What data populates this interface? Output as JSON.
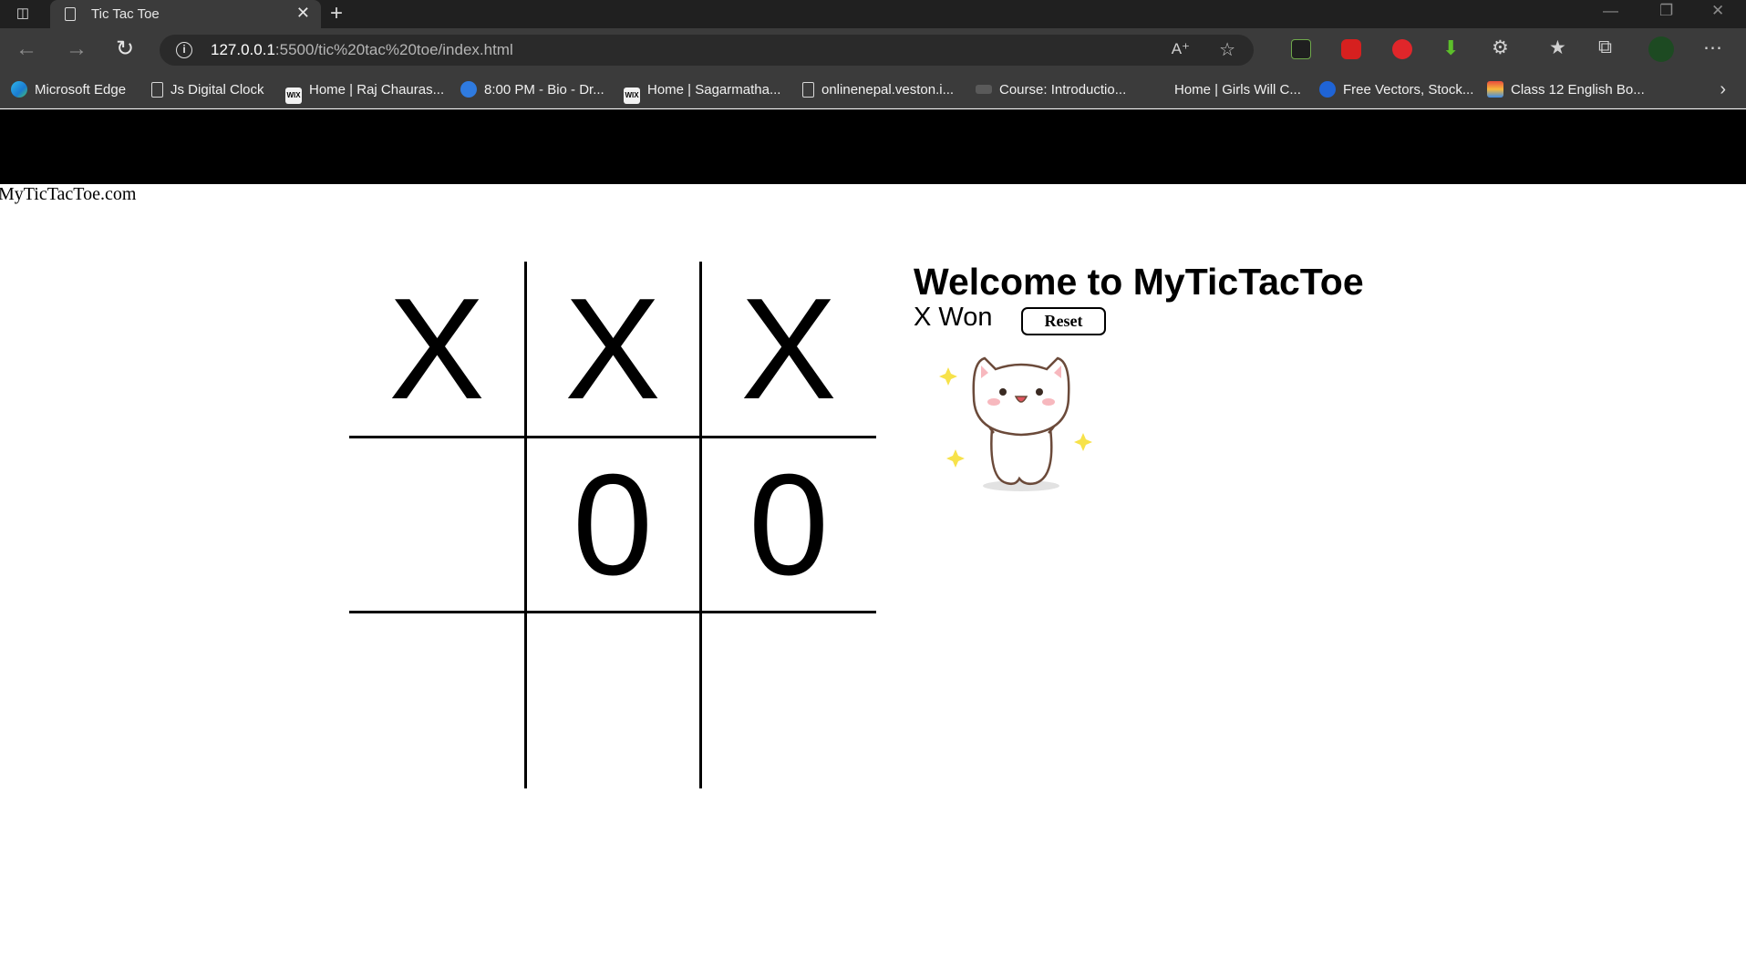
{
  "browser": {
    "tab_title": "Tic Tac Toe",
    "url_host": "127.0.0.1",
    "url_rest": ":5500/tic%20tac%20toe/index.html",
    "bookmarks": [
      {
        "label": "Microsoft Edge",
        "icon": "edge-icon"
      },
      {
        "label": "Js Digital Clock",
        "icon": "doc-icon"
      },
      {
        "label": "Home | Raj Chauras...",
        "icon": "wix-icon"
      },
      {
        "label": "8:00 PM - Bio - Dr...",
        "icon": "check-icon"
      },
      {
        "label": "Home | Sagarmatha...",
        "icon": "wix-icon"
      },
      {
        "label": "onlinenepal.veston.i...",
        "icon": "doc-icon"
      },
      {
        "label": "Course: Introductio...",
        "icon": "moodle-icon"
      },
      {
        "label": "Home | Girls Will C...",
        "icon": "blank-icon"
      },
      {
        "label": "Free Vectors, Stock...",
        "icon": "freepik-icon"
      },
      {
        "label": "Class 12 English Bo...",
        "icon": "book-icon"
      }
    ],
    "wix_text": "WIX"
  },
  "page": {
    "site_name": "MyTicTacToe.com",
    "welcome": "Welcome to MyTicTacToe",
    "status": "X Won",
    "reset_label": "Reset"
  },
  "board": [
    "X",
    "X",
    "X",
    "",
    "0",
    "0",
    "",
    "",
    ""
  ],
  "colors": {
    "chrome_dark": "#202020",
    "chrome": "#3b3b3b",
    "header_bar": "#000000"
  }
}
